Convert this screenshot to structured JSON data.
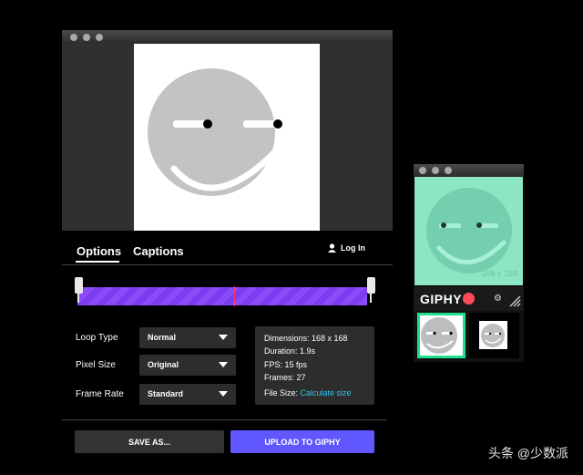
{
  "tabs": [
    {
      "label": "Options",
      "active": true
    },
    {
      "label": "Captions",
      "active": false
    }
  ],
  "login": {
    "label": "Log In",
    "icon": "user-icon"
  },
  "options": {
    "loop_type": {
      "label": "Loop Type",
      "value": "Normal"
    },
    "pixel_size": {
      "label": "Pixel Size",
      "value": "Original"
    },
    "frame_rate": {
      "label": "Frame Rate",
      "value": "Standard"
    }
  },
  "info": {
    "dimensions": "Dimensions: 168 x 168",
    "duration": "Duration: 1.9s",
    "fps": "FPS: 15 fps",
    "frames": "Frames: 27",
    "file_size_label": "File Size:",
    "calculate_link": "Calculate size"
  },
  "buttons": {
    "save_as": "SAVE AS...",
    "upload": "UPLOAD TO GIPHY"
  },
  "side": {
    "dimension_text": "168 x 168",
    "brand": "GIPHY",
    "settings_icon": "gear-icon"
  },
  "watermark": "头条 @少数派",
  "colors": {
    "accent_purple": "#6157ff",
    "timeline_purple": "#7b3cf2",
    "mint": "#8ce6c4",
    "link_blue": "#2fc6f2",
    "record_red": "#ff4a5a",
    "thumb_green": "#1fe08c"
  }
}
